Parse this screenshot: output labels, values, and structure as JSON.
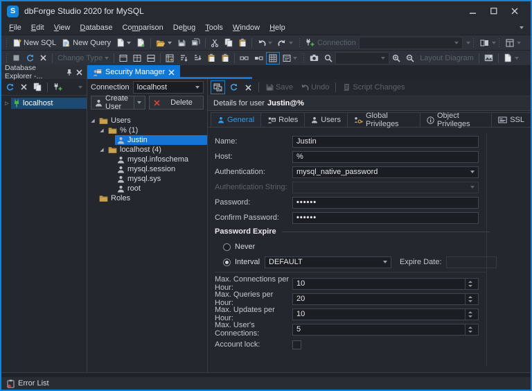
{
  "window": {
    "title": "dbForge Studio 2020 for MySQL",
    "logo_letter": "S"
  },
  "menu": {
    "items": [
      {
        "label": "File",
        "underline": 0
      },
      {
        "label": "Edit",
        "underline": 0
      },
      {
        "label": "View",
        "underline": 0
      },
      {
        "label": "Database",
        "underline": 0
      },
      {
        "label": "Comparison",
        "underline": 2
      },
      {
        "label": "Debug",
        "underline": 2
      },
      {
        "label": "Tools",
        "underline": 0
      },
      {
        "label": "Window",
        "underline": 0
      },
      {
        "label": "Help",
        "underline": 0
      }
    ]
  },
  "toolbar1": {
    "new_sql": "New SQL",
    "new_query": "New Query",
    "connection_label": "Connection",
    "connection_value": ""
  },
  "toolbar2": {
    "change_type": "Change Type",
    "zoom_value": "",
    "layout_diagram": "Layout Diagram"
  },
  "explorer": {
    "title": "Database Explorer -...",
    "tree": [
      {
        "label": "localhost",
        "icon": "plug",
        "expander": "collapsed",
        "level": 0,
        "selected": "dim"
      }
    ]
  },
  "doc": {
    "tab_label": "Security Manager"
  },
  "security": {
    "connection_label": "Connection",
    "connection_value": "localhost",
    "create_user_label": "Create User",
    "delete_label": "Delete",
    "tree": [
      {
        "label": "Users",
        "icon": "folder",
        "expander": "expanded",
        "level": 0
      },
      {
        "label": "% (1)",
        "icon": "folder",
        "expander": "expanded",
        "level": 1
      },
      {
        "label": "Justin",
        "icon": "user",
        "expander": "none",
        "level": 2,
        "selected": "bright"
      },
      {
        "label": "localhost (4)",
        "icon": "folder",
        "expander": "expanded",
        "level": 1
      },
      {
        "label": "mysql.infoschema",
        "icon": "user",
        "expander": "none",
        "level": 2
      },
      {
        "label": "mysql.session",
        "icon": "user",
        "expander": "none",
        "level": 2
      },
      {
        "label": "mysql.sys",
        "icon": "user",
        "expander": "none",
        "level": 2
      },
      {
        "label": "root",
        "icon": "user",
        "expander": "none",
        "level": 2
      },
      {
        "label": "Roles",
        "icon": "folder",
        "expander": "none",
        "level": 0
      }
    ]
  },
  "details": {
    "toolbar": {
      "save": "Save",
      "undo": "Undo",
      "script_changes": "Script Changes"
    },
    "header_prefix": "Details for user",
    "header_user": "Justin@%",
    "tabs": [
      {
        "label": "General",
        "icon": "user-blue",
        "active": true
      },
      {
        "label": "Roles",
        "icon": "roles",
        "active": false
      },
      {
        "label": "Users",
        "icon": "user-gray",
        "active": false
      },
      {
        "label": "Global Privileges",
        "icon": "keypriv",
        "active": false
      },
      {
        "label": "Object Privileges",
        "icon": "infoc",
        "active": false
      },
      {
        "label": "SSL",
        "icon": "sslcard",
        "active": false
      }
    ]
  },
  "form": {
    "rows": [
      {
        "label": "Name:",
        "kind": "text",
        "value": "Justin",
        "disabled": false
      },
      {
        "label": "Host:",
        "kind": "text",
        "value": "%",
        "disabled": false
      },
      {
        "label": "Authentication:",
        "kind": "combo",
        "value": "mysql_native_password",
        "disabled": false
      },
      {
        "label": "Authentication String:",
        "kind": "combo",
        "value": "",
        "disabled": true
      },
      {
        "label": "Password:",
        "kind": "password",
        "value": "••••••",
        "disabled": false
      },
      {
        "label": "Confirm Password:",
        "kind": "password",
        "value": "••••••",
        "disabled": false
      }
    ],
    "expire": {
      "title": "Password Expire",
      "never_label": "Never",
      "interval_label": "Interval",
      "selected": "interval",
      "interval_value": "DEFAULT",
      "expire_date_label": "Expire Date:",
      "expire_date_value": ""
    },
    "limits": [
      {
        "label": "Max. Connections per Hour:",
        "value": "10"
      },
      {
        "label": "Max. Queries per Hour:",
        "value": "20"
      },
      {
        "label": "Max. Updates per Hour:",
        "value": "10"
      },
      {
        "label": "Max. User's Connections:",
        "value": "5"
      }
    ],
    "lock": {
      "label": "Account lock:",
      "checked": false
    }
  },
  "statusbar": {
    "error_list": "Error List"
  },
  "colors": {
    "accent": "#1079d8",
    "selection_bright": "#1574d4",
    "selection_dim": "#1c4a73",
    "folder": "#caa34e",
    "plug_green": "#4cb648",
    "delete_red": "#d04437"
  }
}
